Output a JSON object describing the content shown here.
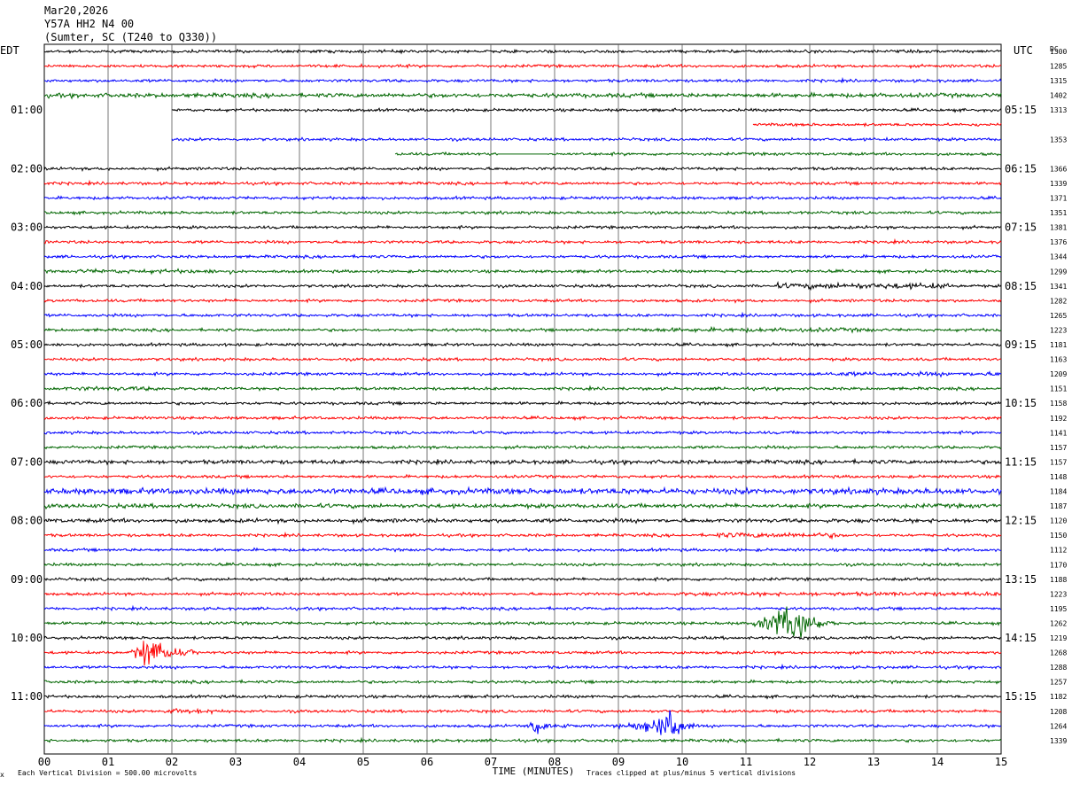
{
  "header": {
    "line1": "Mar20,2026",
    "line2": "Y57A HH2 N4 00",
    "line3": "(Sumter, SC (T240 to Q330))"
  },
  "left_tz": "EDT",
  "right_tz": "UTC",
  "dc_label": "DC",
  "footer": {
    "scale_note": "Each Vertical Division =  500.00 microvolts",
    "clip_note": "Traces clipped at plus/minus 5 vertical divisions",
    "corner_mark": "x"
  },
  "colors": {
    "trace_cycle": [
      "#000000",
      "#ff0000",
      "#0000ff",
      "#006600"
    ],
    "grid": "#000000",
    "background": "#ffffff"
  },
  "chart_data": {
    "type": "line",
    "title": "Y57A HH2 N4 00",
    "xlabel": "TIME (MINUTES)",
    "ylabel": "",
    "xlim": [
      0,
      15
    ],
    "x_ticks": [
      "00",
      "01",
      "02",
      "03",
      "04",
      "05",
      "06",
      "07",
      "08",
      "09",
      "10",
      "11",
      "12",
      "13",
      "14",
      "15"
    ],
    "minutes_per_row": 15,
    "row_count": 48,
    "left_hour_labels": [
      {
        "row": 4,
        "label": "01:00"
      },
      {
        "row": 8,
        "label": "02:00"
      },
      {
        "row": 12,
        "label": "03:00"
      },
      {
        "row": 16,
        "label": "04:00"
      },
      {
        "row": 20,
        "label": "05:00"
      },
      {
        "row": 24,
        "label": "06:00"
      },
      {
        "row": 28,
        "label": "07:00"
      },
      {
        "row": 32,
        "label": "08:00"
      },
      {
        "row": 36,
        "label": "09:00"
      },
      {
        "row": 40,
        "label": "10:00"
      },
      {
        "row": 44,
        "label": "11:00"
      }
    ],
    "right_hour_labels": [
      {
        "row": 4,
        "label": "05:15"
      },
      {
        "row": 8,
        "label": "06:15"
      },
      {
        "row": 12,
        "label": "07:15"
      },
      {
        "row": 16,
        "label": "08:15"
      },
      {
        "row": 20,
        "label": "09:15"
      },
      {
        "row": 24,
        "label": "10:15"
      },
      {
        "row": 28,
        "label": "11:15"
      },
      {
        "row": 32,
        "label": "12:15"
      },
      {
        "row": 36,
        "label": "13:15"
      },
      {
        "row": 40,
        "label": "14:15"
      },
      {
        "row": 44,
        "label": "15:15"
      }
    ],
    "dc_offsets": [
      {
        "row": 0,
        "value": "1300"
      },
      {
        "row": 1,
        "value": "1285"
      },
      {
        "row": 2,
        "value": "1315"
      },
      {
        "row": 3,
        "value": "1402"
      },
      {
        "row": 4,
        "value": "1313"
      },
      {
        "row": 6,
        "value": "1353"
      },
      {
        "row": 8,
        "value": "1366"
      },
      {
        "row": 9,
        "value": "1339"
      },
      {
        "row": 10,
        "value": "1371"
      },
      {
        "row": 11,
        "value": "1351"
      },
      {
        "row": 12,
        "value": "1381"
      },
      {
        "row": 13,
        "value": "1376"
      },
      {
        "row": 14,
        "value": "1344"
      },
      {
        "row": 15,
        "value": "1299"
      },
      {
        "row": 16,
        "value": "1341"
      },
      {
        "row": 17,
        "value": "1282"
      },
      {
        "row": 18,
        "value": "1265"
      },
      {
        "row": 19,
        "value": "1223"
      },
      {
        "row": 20,
        "value": "1181"
      },
      {
        "row": 21,
        "value": "1163"
      },
      {
        "row": 22,
        "value": "1209"
      },
      {
        "row": 23,
        "value": "1151"
      },
      {
        "row": 24,
        "value": "1158"
      },
      {
        "row": 25,
        "value": "1192"
      },
      {
        "row": 26,
        "value": "1141"
      },
      {
        "row": 27,
        "value": "1157"
      },
      {
        "row": 28,
        "value": "1157"
      },
      {
        "row": 29,
        "value": "1148"
      },
      {
        "row": 30,
        "value": "1184"
      },
      {
        "row": 31,
        "value": "1187"
      },
      {
        "row": 32,
        "value": "1120"
      },
      {
        "row": 33,
        "value": "1150"
      },
      {
        "row": 34,
        "value": "1112"
      },
      {
        "row": 35,
        "value": "1170"
      },
      {
        "row": 36,
        "value": "1188"
      },
      {
        "row": 37,
        "value": "1223"
      },
      {
        "row": 38,
        "value": "1195"
      },
      {
        "row": 39,
        "value": "1262"
      },
      {
        "row": 40,
        "value": "1219"
      },
      {
        "row": 41,
        "value": "1268"
      },
      {
        "row": 42,
        "value": "1288"
      },
      {
        "row": 43,
        "value": "1257"
      },
      {
        "row": 44,
        "value": "1182"
      },
      {
        "row": 45,
        "value": "1208"
      },
      {
        "row": 46,
        "value": "1264"
      },
      {
        "row": 47,
        "value": "1339"
      }
    ],
    "data_gaps": [
      {
        "row": 4,
        "from_min": 0,
        "to_min": 2
      },
      {
        "row": 5,
        "from_min": 0,
        "to_min": 11.1
      },
      {
        "row": 6,
        "from_min": 0,
        "to_min": 2
      },
      {
        "row": 7,
        "from_min": 0,
        "to_min": 5.5
      }
    ],
    "flat_segments": [
      {
        "row": 4,
        "from_min": 0.9,
        "to_min": 2
      },
      {
        "row": 7,
        "from_min": 7.1,
        "to_min": 7.9
      }
    ],
    "noise_bursts": [
      {
        "row": 3,
        "from_min": 0,
        "to_min": 15,
        "amp": 1.6
      },
      {
        "row": 15,
        "from_min": 0.5,
        "to_min": 3,
        "amp": 1.6
      },
      {
        "row": 16,
        "from_min": 11.5,
        "to_min": 14.2,
        "amp": 2.2
      },
      {
        "row": 19,
        "from_min": 9,
        "to_min": 13,
        "amp": 1.6
      },
      {
        "row": 22,
        "from_min": 12,
        "to_min": 15,
        "amp": 1.6
      },
      {
        "row": 23,
        "from_min": 0.3,
        "to_min": 2,
        "amp": 1.6
      },
      {
        "row": 28,
        "from_min": 0,
        "to_min": 15,
        "amp": 1.5
      },
      {
        "row": 30,
        "from_min": 0,
        "to_min": 15,
        "amp": 2.2
      },
      {
        "row": 31,
        "from_min": 0,
        "to_min": 15,
        "amp": 1.6
      },
      {
        "row": 32,
        "from_min": 0,
        "to_min": 15,
        "amp": 1.5
      },
      {
        "row": 33,
        "from_min": 10.5,
        "to_min": 12.5,
        "amp": 2.0
      },
      {
        "row": 37,
        "from_min": 10,
        "to_min": 15,
        "amp": 1.5
      }
    ],
    "events": [
      {
        "row": 39,
        "start_min": 11.1,
        "end_min": 12.4,
        "peak_min": 11.8,
        "amp": 18
      },
      {
        "row": 41,
        "start_min": 1.35,
        "end_min": 2.5,
        "peak_min": 1.6,
        "amp": 14
      },
      {
        "row": 46,
        "start_min": 7.5,
        "end_min": 8.3,
        "peak_min": 7.7,
        "amp": 7
      },
      {
        "row": 46,
        "start_min": 8.8,
        "end_min": 9.8,
        "peak_min": 9.4,
        "amp": 4
      },
      {
        "row": 46,
        "start_min": 9.3,
        "end_min": 10.2,
        "peak_min": 9.85,
        "amp": 16
      },
      {
        "row": 45,
        "start_min": 1.8,
        "end_min": 3.3,
        "peak_min": 2.0,
        "amp": 2.5
      }
    ]
  }
}
